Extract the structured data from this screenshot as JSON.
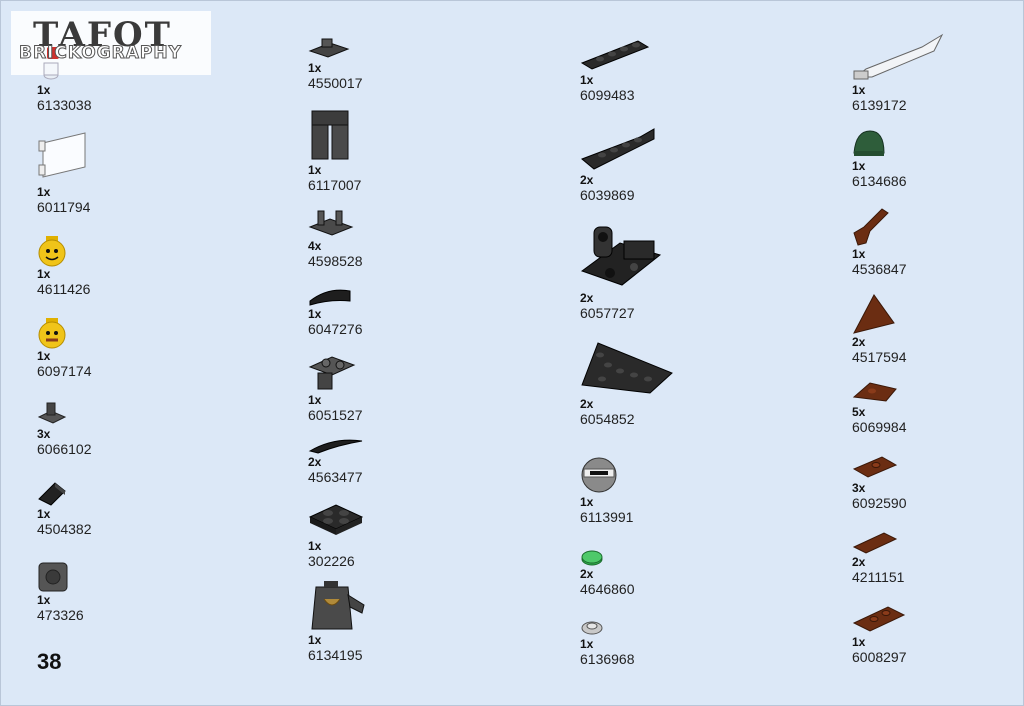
{
  "watermark": {
    "top_text": "TAFOT",
    "brand": "BRICKOGRAPHY"
  },
  "page_number": "38",
  "columns": [
    [
      {
        "qty": "1x",
        "id": "6133038",
        "icon": "clear-stud-icon"
      },
      {
        "qty": "1x",
        "id": "6011794",
        "icon": "white-flag-icon"
      },
      {
        "qty": "1x",
        "id": "4611426",
        "icon": "yellow-head-icon"
      },
      {
        "qty": "1x",
        "id": "6097174",
        "icon": "yellow-head-icon"
      },
      {
        "qty": "3x",
        "id": "6066102",
        "icon": "dark-grey-bracket-icon"
      },
      {
        "qty": "1x",
        "id": "4504382",
        "icon": "black-slope-icon"
      },
      {
        "qty": "1x",
        "id": "473326",
        "icon": "grey-brick-round-icon"
      }
    ],
    [
      {
        "qty": "1x",
        "id": "4550017",
        "icon": "dark-grey-plate-clip-icon"
      },
      {
        "qty": "1x",
        "id": "6117007",
        "icon": "dark-grey-legs-icon"
      },
      {
        "qty": "4x",
        "id": "4598528",
        "icon": "dark-grey-plate-bar-icon"
      },
      {
        "qty": "1x",
        "id": "6047276",
        "icon": "black-curved-slope-icon"
      },
      {
        "qty": "1x",
        "id": "6051527",
        "icon": "dark-grey-plate-hinge-icon"
      },
      {
        "qty": "2x",
        "id": "4563477",
        "icon": "black-claw-icon"
      },
      {
        "qty": "1x",
        "id": "302226",
        "icon": "black-plate-2x2-icon"
      },
      {
        "qty": "1x",
        "id": "6134195",
        "icon": "dark-grey-torso-icon"
      }
    ],
    [
      {
        "qty": "1x",
        "id": "6099483",
        "icon": "black-plate-1x4-icon"
      },
      {
        "qty": "2x",
        "id": "6039869",
        "icon": "black-curved-plate-icon"
      },
      {
        "qty": "2x",
        "id": "6057727",
        "icon": "black-technic-bracket-icon"
      },
      {
        "qty": "2x",
        "id": "6054852",
        "icon": "black-wedge-plate-icon"
      },
      {
        "qty": "1x",
        "id": "6113991",
        "icon": "ninja-head-icon"
      },
      {
        "qty": "2x",
        "id": "4646860",
        "icon": "green-round-tile-icon"
      },
      {
        "qty": "1x",
        "id": "6136968",
        "icon": "grey-round-plate-icon"
      }
    ],
    [
      {
        "qty": "1x",
        "id": "6139172",
        "icon": "silver-sword-icon"
      },
      {
        "qty": "1x",
        "id": "6134686",
        "icon": "green-helmet-icon"
      },
      {
        "qty": "1x",
        "id": "4536847",
        "icon": "brown-pistol-icon"
      },
      {
        "qty": "2x",
        "id": "4517594",
        "icon": "brown-triangle-icon"
      },
      {
        "qty": "5x",
        "id": "6069984",
        "icon": "brown-corner-plate-icon"
      },
      {
        "qty": "3x",
        "id": "6092590",
        "icon": "brown-plate-stud-icon"
      },
      {
        "qty": "2x",
        "id": "4211151",
        "icon": "brown-tile-icon"
      },
      {
        "qty": "1x",
        "id": "6008297",
        "icon": "brown-plate-2x1-icon"
      }
    ]
  ],
  "colors": {
    "background": "#dce8f7",
    "dark_grey": "#4a4a4a",
    "black": "#1e1e1e",
    "brown": "#6b2d12",
    "yellow": "#f0c419",
    "green": "#2e5d3a"
  }
}
